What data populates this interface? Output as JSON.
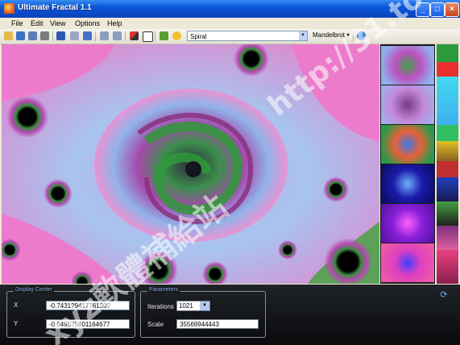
{
  "window": {
    "title": "Ultimate Fractal 1.1"
  },
  "menu": [
    "File",
    "Edit",
    "View",
    "Options",
    "Help"
  ],
  "toolbar": {
    "preset": "Spiral",
    "fractal_type": "Mandelbrot"
  },
  "display": {
    "group_title": "Display Center",
    "x_label": "X",
    "x_value": "-0.7431?941776130?",
    "y_label": "Y",
    "y_value": "-0.649575801164677"
  },
  "parameters": {
    "group_title": "Parameters",
    "iterations_label": "Iterations",
    "iterations_value": "1021",
    "scale_label": "Scale",
    "scale_value": "35569944443"
  },
  "watermark": {
    "url": "http://31.to",
    "text": "xyz軟體補給站"
  }
}
